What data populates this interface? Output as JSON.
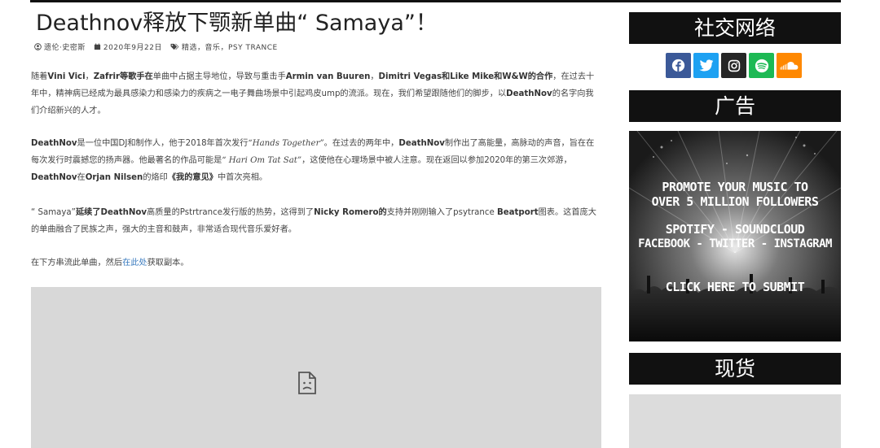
{
  "post": {
    "title": "Deathnov释放下颚新单曲“ Samaya”！",
    "author": "遗伦·史密斯",
    "date": "2020年9月22日",
    "tags": "精选，音乐，PSY TRANCE"
  },
  "p1": {
    "t1": "随着",
    "b1": "Vini Vici",
    "t2": "，",
    "b2": "Zafrir等歌手在",
    "t3": "单曲中占据主导地位，导致与重击手",
    "b3": "Armin van Buuren",
    "t4": "，",
    "b4": "Dimitri Vegas和Like Mike和W&W的合作",
    "t5": "，在过去十年中，精神病已经成为最具感染力和感染力的疾病之一电子舞曲场景中引起鸡皮ump的流派。现在，我们希望跟随他们的脚步，以",
    "b5": "DeathNov",
    "t6": "的名字向我们介绍新兴的人才。"
  },
  "p2": {
    "b1": "DeathNov",
    "t1": "是一位中国DJ和制作人，他于2018年首次发行",
    "i1": "“Hands Together”",
    "t2": "。在过去的两年中，",
    "b2": "DeathNov",
    "t3": "制作出了高能量，高脉动的声音，旨在在每次发行时震撼您的扬声器。他最著名的作品可能是",
    "i2": "“ Hari Om Tat Sat”",
    "t4": "，这使他在心理场景中被人注意。现在返回以参加2020年的第三次郊游，",
    "b3": "DeathNov",
    "t5": "在",
    "b4": "Orjan Nilsen",
    "t6": "的烙印",
    "b5": "《我的意见》",
    "t7": "中首次亮相。"
  },
  "p3": {
    "t1": "“ Samaya”",
    "b1": "延续了",
    "b2": "DeathNov",
    "t2": "高质量的Pstrtrance发行版的热势，这得到了",
    "b3": "Nicky Romero的",
    "t3": "支持并刚刚输入了psytrance ",
    "b4": "Beatport",
    "t4": "图表。这首庞大的单曲融合了民族之声，强大的主音和鼓声，非常适合现代音乐爱好者。"
  },
  "p4": {
    "t1": "在下方串流此单曲，然后",
    "link": "在此处",
    "t2": "获取副本。"
  },
  "sidebar": {
    "social_title": "社交网络",
    "ad_title": "广告",
    "stock_title": "现货",
    "social_icons": [
      {
        "name": "facebook-icon",
        "color": "#3b5998"
      },
      {
        "name": "twitter-icon",
        "color": "#1da1f2"
      },
      {
        "name": "instagram-icon",
        "color": "#262626"
      },
      {
        "name": "spotify-icon",
        "color": "#1db954"
      },
      {
        "name": "soundcloud-icon",
        "color": "#ff8800"
      }
    ],
    "ad": {
      "line1": "PROMOTE YOUR MUSIC TO",
      "line2": "OVER 5 MILLION FOLLOWERS",
      "line3": "SPOTIFY - SOUNDCLOUD",
      "line4": "FACEBOOK - TWITTER - INSTAGRAM",
      "line5": "CLICK HERE TO SUBMIT"
    }
  }
}
